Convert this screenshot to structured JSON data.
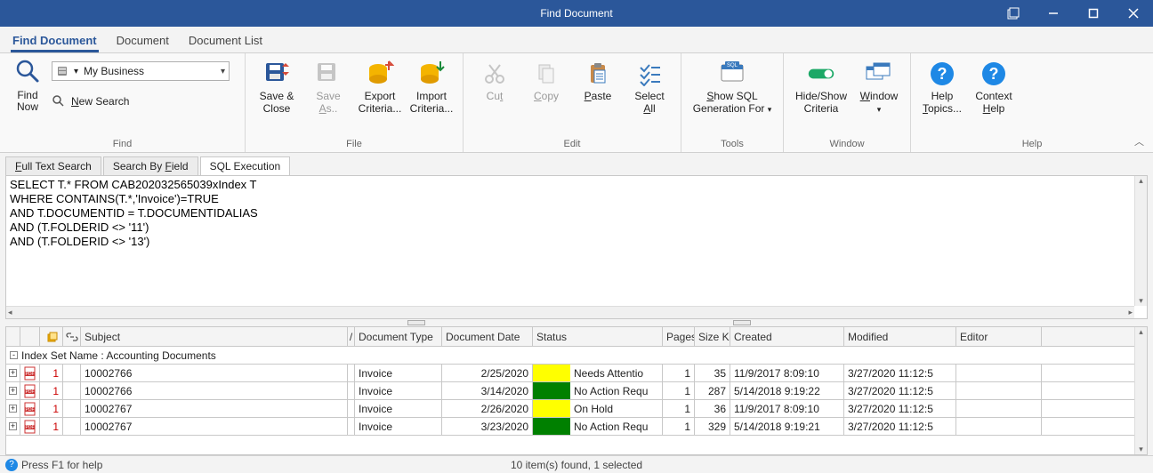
{
  "window": {
    "title": "Find Document"
  },
  "menu": {
    "find_document": "Find Document",
    "document": "Document",
    "document_list": "Document List"
  },
  "ribbon": {
    "find": {
      "label": "Find",
      "find_now": "Find\nNow",
      "new_search_prefix": "N",
      "new_search_rest": "ew Search",
      "scope": "My Business"
    },
    "file": {
      "label": "File",
      "save_close": "Save &\nClose",
      "save_as_prefix": "Save\n",
      "save_as_ul": "A",
      "save_as_rest": "s..",
      "export": "Export\nCriteria...",
      "import": "Import\nCriteria..."
    },
    "edit": {
      "label": "Edit",
      "cut_ul": "t",
      "cut_pre": "Cu",
      "copy_ul": "C",
      "copy_rest": "opy",
      "paste_ul": "P",
      "paste_rest": "aste",
      "select_all_pre": "Select\n",
      "select_all_ul": "A",
      "select_all_rest": "ll"
    },
    "tools": {
      "label": "Tools",
      "show_sql_ul": "S",
      "show_sql_rest": "how SQL\nGeneration For"
    },
    "window_group": {
      "label": "Window",
      "hideshow": "Hide/Show\nCriteria",
      "window_ul": "W",
      "window_rest": "indow"
    },
    "help": {
      "label": "Help",
      "help_topics_pre": "Help\n",
      "help_topics_ul": "T",
      "help_topics_rest": "opics...",
      "context_pre": "Context\n",
      "context_ul": "H",
      "context_rest": "elp"
    }
  },
  "subtabs": {
    "full_text_ul": "F",
    "full_text_rest": "ull Text Search",
    "by_field_pre": "Search By ",
    "by_field_ul": "F",
    "by_field_rest": "ield",
    "sql": "SQL Execution"
  },
  "sql": "SELECT T.* FROM CAB202032565039xIndex T\nWHERE CONTAINS(T.*,'Invoice')=TRUE\nAND T.DOCUMENTID = T.DOCUMENTIDALIAS\nAND (T.FOLDERID <> '11')\nAND (T.FOLDERID <> '13')",
  "grid": {
    "columns": {
      "subject": "Subject",
      "doc_type": "Document Type",
      "doc_date": "Document Date",
      "status": "Status",
      "pages": "Pages",
      "size": "Size K",
      "created": "Created",
      "modified": "Modified",
      "editor": "Editor"
    },
    "group_row": "Index Set Name : Accounting Documents",
    "rows": [
      {
        "ver": "1",
        "subject": "10002766",
        "doc_type": "Invoice",
        "doc_date": "2/25/2020",
        "status_color": "#ffff00",
        "status_text": "Needs Attentio",
        "pages": "1",
        "size": "35",
        "created": "11/9/2017 8:09:10",
        "modified": "3/27/2020 11:12:5",
        "editor": "",
        "icon": "pdf"
      },
      {
        "ver": "1",
        "subject": "10002766",
        "doc_type": "Invoice",
        "doc_date": "3/14/2020",
        "status_color": "#008000",
        "status_text": "No Action Requ",
        "pages": "1",
        "size": "287",
        "created": "5/14/2018 9:19:22",
        "modified": "3/27/2020 11:12:5",
        "editor": "",
        "icon": "pdf"
      },
      {
        "ver": "1",
        "subject": "10002767",
        "doc_type": "Invoice",
        "doc_date": "2/26/2020",
        "status_color": "#ffff00",
        "status_text": "On Hold",
        "pages": "1",
        "size": "36",
        "created": "11/9/2017 8:09:10",
        "modified": "3/27/2020 11:12:5",
        "editor": "",
        "icon": "pdf"
      },
      {
        "ver": "1",
        "subject": "10002767",
        "doc_type": "Invoice",
        "doc_date": "3/23/2020",
        "status_color": "#008000",
        "status_text": "No Action Requ",
        "pages": "1",
        "size": "329",
        "created": "5/14/2018 9:19:21",
        "modified": "3/27/2020 11:12:5",
        "editor": "",
        "icon": "pdf"
      }
    ]
  },
  "status": {
    "help": "Press F1 for help",
    "summary": "10 item(s) found, 1 selected"
  }
}
